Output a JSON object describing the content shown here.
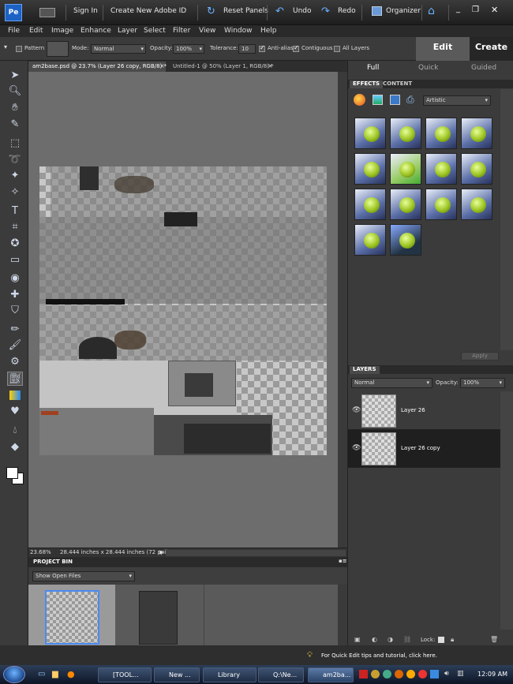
{
  "titlebar": {
    "sign_in": "Sign In",
    "create_id": "Create New Adobe ID",
    "reset_panels": "Reset Panels",
    "undo": "Undo",
    "redo": "Redo",
    "organizer": "Organizer"
  },
  "menu": [
    "File",
    "Edit",
    "Image",
    "Enhance",
    "Layer",
    "Select",
    "Filter",
    "View",
    "Window",
    "Help"
  ],
  "options": {
    "pattern_label": "Pattern",
    "mode_label": "Mode:",
    "mode_value": "Normal",
    "opacity_label": "Opacity:",
    "opacity_value": "100%",
    "tolerance_label": "Tolerance:",
    "tolerance_value": "10",
    "antialias_label": "Anti-alias",
    "contiguous_label": "Contiguous",
    "all_layers_label": "All Layers"
  },
  "mode_tabs": {
    "edit": "Edit",
    "create": "Create"
  },
  "edit_subtabs": {
    "full": "Full",
    "quick": "Quick",
    "guided": "Guided"
  },
  "doc_tabs": [
    "am2base.psd @ 23.7% (Layer 26 copy, RGB/8) *",
    "Untitled-1 @ 50% (Layer 1, RGB/8) *"
  ],
  "status": {
    "zoom": "23.68%",
    "size": "28.444 inches x 28.444 inches (72 ppi)"
  },
  "project_bin": {
    "title": "PROJECT BIN",
    "show_value": "Show Open Files"
  },
  "effects_panel": {
    "tab_effects": "EFFECTS",
    "tab_content": "CONTENT",
    "category": "Artistic",
    "apply": "Apply"
  },
  "layers_panel": {
    "title": "LAYERS",
    "blend": "Normal",
    "opacity_label": "Opacity:",
    "opacity_value": "100%",
    "lock_label": "Lock:",
    "layers": [
      {
        "name": "Layer 26",
        "selected": false
      },
      {
        "name": "Layer 26 copy",
        "selected": true
      }
    ]
  },
  "tip": "For Quick Edit tips and tutorial, click here.",
  "taskbar": {
    "items": [
      "[TOOL...",
      "New ...",
      "Library",
      "Q:\\Ne...",
      "am2ba..."
    ],
    "clock": "12:09 AM"
  }
}
